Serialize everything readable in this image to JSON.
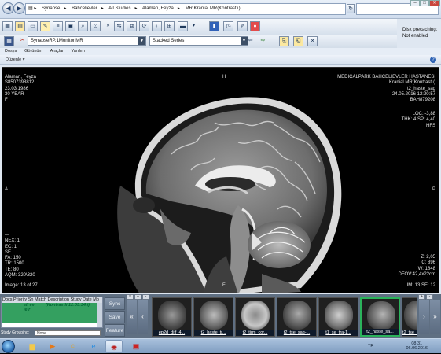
{
  "address_bar": {
    "crumbs": [
      "Synapse",
      "Bahcelievler",
      "All Studies",
      "Alaman, Feyza",
      "MR Kranial MR(Kontrastlı)"
    ],
    "window_controls": [
      "–",
      "□",
      "✕"
    ]
  },
  "status": {
    "disk_precaching_label": "Disk precaching:",
    "disk_precaching_value": "Not enabled"
  },
  "toolbar2": {
    "layout_combo": "SynapseRP,1Monitor,MR",
    "series_combo": "Stacked Series"
  },
  "menu": {
    "items": [
      "Dosya",
      "Görünüm",
      "Araçlar",
      "Yardım"
    ],
    "sub": "Düzenle"
  },
  "overlay": {
    "top_left": "Alaman, Feyza\nS8507398812\n23.03.1986\n30 YEAR\nF",
    "top_center": "H",
    "top_right": "MEDICALPARK BAHCELIEVLER HASTANESI\nKranial MR(Kontrastlı)\nt2_haste_sag\n24.05.2016 12:20:57\nBAH879208",
    "right_mid": "LOC: -3,88\nTHK: 4 SP: 4,40\nHFS",
    "left_marker": "A",
    "right_marker": "P",
    "left_bottom": "---\nNEX: 1\nEC: 1\nSE\nFA: 150\nTR: 1500\nTE: 80\nAQM: 320\\320",
    "right_bottom": "Z: 2,05\nC: 896\nW: 1848\nDFOV:42,4x22cm",
    "image_count": "Image: 13 of 27",
    "bottom_center": "F",
    "bottom_right": "IM: 13 SE: 12"
  },
  "study_list": {
    "header": "Docs Priority Sn Match Description Study Date Mo",
    "row_col1": "ell ev le r",
    "row_col2": "(Kontrastli 12:05:34 i)",
    "grouping_label": "Study Grouping:",
    "grouping_value": "None"
  },
  "side_buttons": [
    "Sync",
    "Save",
    "Feature"
  ],
  "thumbnails": [
    {
      "label": "ep2d_diff_4..."
    },
    {
      "label": "t2_haste_tr..."
    },
    {
      "label": "t2_tirm_cor..."
    },
    {
      "label": "t2_tse_sag-..."
    },
    {
      "label": "t1_se_tra-1..."
    },
    {
      "label": "t2_haste_sa..."
    },
    {
      "label": "t2_tse_..."
    }
  ],
  "taskbar": {
    "lang": "TR",
    "time": "08:31",
    "date": "06.06.2016"
  },
  "colors": {
    "selected_thumb": "#2bb35b",
    "study_row": "#34a060",
    "panel_bg": "#5f6f82"
  }
}
